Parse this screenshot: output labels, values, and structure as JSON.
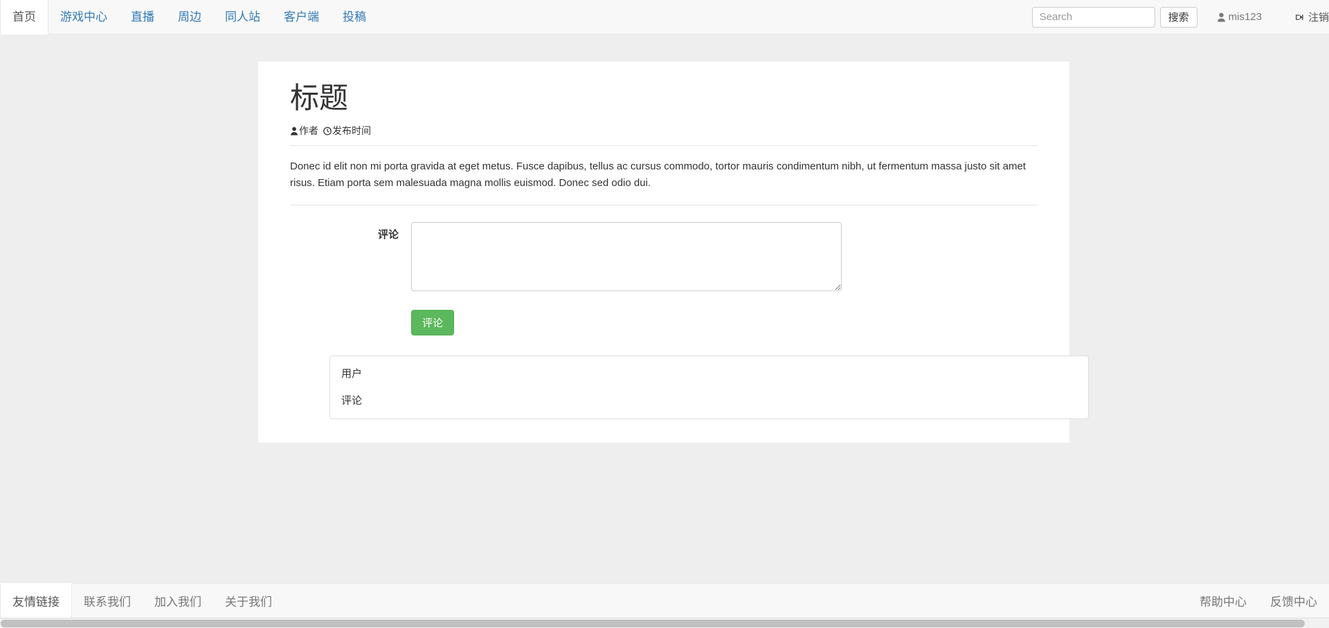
{
  "navbar": {
    "items": [
      {
        "label": "首页",
        "active": true
      },
      {
        "label": "游戏中心",
        "active": false
      },
      {
        "label": "直播",
        "active": false
      },
      {
        "label": "周边",
        "active": false
      },
      {
        "label": "同人站",
        "active": false
      },
      {
        "label": "客户端",
        "active": false
      },
      {
        "label": "投稿",
        "active": false
      }
    ],
    "search": {
      "placeholder": "Search",
      "value": "",
      "button_label": "搜索",
      "icon": "search-icon"
    },
    "user": {
      "name": "mis123",
      "icon": "user-icon"
    },
    "logout": {
      "label": "注销",
      "icon": "sign-out-icon"
    }
  },
  "article": {
    "title": "标题",
    "meta": {
      "author": "作者",
      "author_icon": "user-icon",
      "time": "发布时间",
      "time_icon": "clock-icon"
    },
    "body": "Donec id elit non mi porta gravida at eget metus. Fusce dapibus, tellus ac cursus commodo, tortor mauris condimentum nibh, ut fermentum massa justo sit amet risus. Etiam porta sem malesuada magna mollis euismod. Donec sed odio dui."
  },
  "comment_form": {
    "label": "评论",
    "textarea_value": "",
    "textarea_placeholder": "",
    "submit_label": "评论"
  },
  "comments": [
    {
      "user": "用户",
      "text": "评论"
    }
  ],
  "footer": {
    "left_items": [
      {
        "label": "友情链接",
        "active": true
      },
      {
        "label": "联系我们",
        "active": false
      },
      {
        "label": "加入我们",
        "active": false
      },
      {
        "label": "关于我们",
        "active": false
      }
    ],
    "right_items": [
      {
        "label": "帮助中心"
      },
      {
        "label": "反馈中心"
      }
    ]
  },
  "colors": {
    "link": "#337ab7",
    "navbar_bg": "#f8f8f8",
    "page_bg": "#eeeeee",
    "card_bg": "#ffffff",
    "submit_green": "#5cb85c",
    "muted_text": "#777777"
  }
}
